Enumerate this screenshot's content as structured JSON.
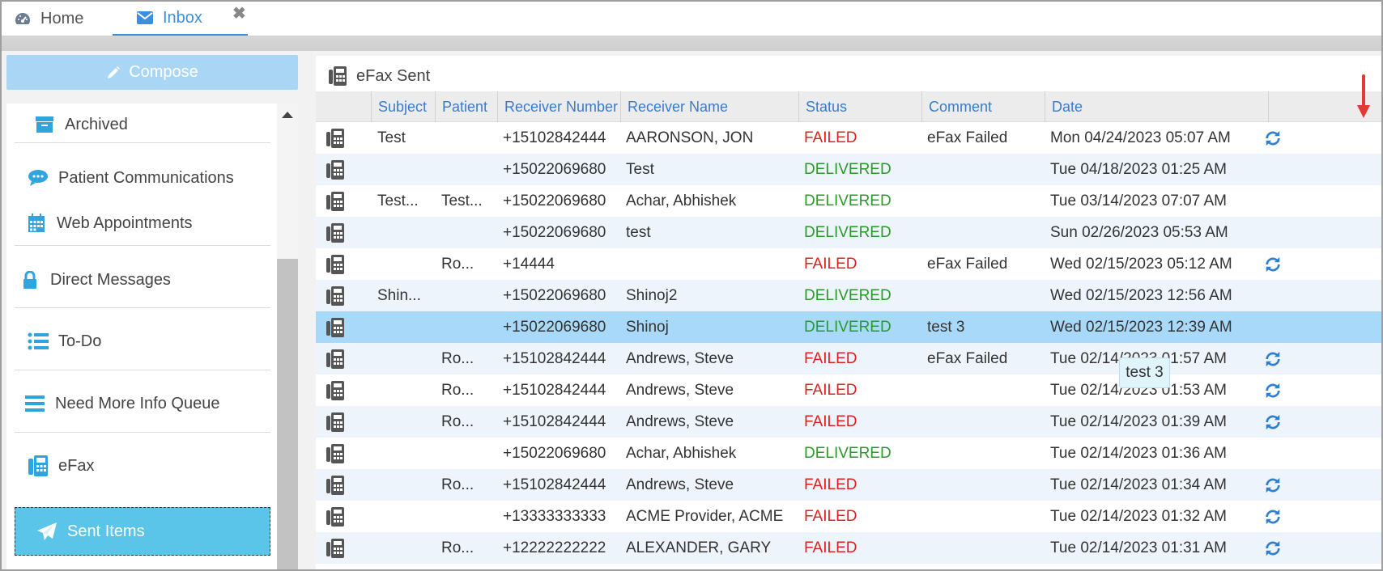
{
  "tabs": {
    "home_label": "Home",
    "inbox_label": "Inbox",
    "close_glyph": "✖"
  },
  "sidebar": {
    "compose_label": "Compose",
    "items": [
      {
        "label": "Archived",
        "icon": "archive-icon"
      },
      {
        "label": "Patient Communications",
        "icon": "chat-icon"
      },
      {
        "label": "Web Appointments",
        "icon": "calendar-icon"
      },
      {
        "label": "Direct Messages",
        "icon": "lock-icon"
      },
      {
        "label": "To-Do",
        "icon": "list-icon"
      },
      {
        "label": "Need More Info Queue",
        "icon": "menu-icon"
      },
      {
        "label": "eFax",
        "icon": "fax-icon"
      },
      {
        "label": "Sent Items",
        "icon": "paper-plane-icon"
      }
    ]
  },
  "panel": {
    "title": "eFax Sent",
    "columns": [
      "Subject",
      "Patient",
      "Receiver Number",
      "Receiver Name",
      "Status",
      "Comment",
      "Date"
    ],
    "rows": [
      {
        "subject": "Test",
        "patient": "",
        "number": "+15102842444",
        "name": "AARONSON, JON",
        "status": "FAILED",
        "comment": "eFax Failed",
        "date": "Mon 04/24/2023 05:07 AM",
        "resend": true
      },
      {
        "subject": "",
        "patient": "",
        "number": "+15022069680",
        "name": "Test",
        "status": "DELIVERED",
        "comment": "",
        "date": "Tue 04/18/2023 01:25 AM",
        "resend": false
      },
      {
        "subject": "Test...",
        "patient": "Test...",
        "number": "+15022069680",
        "name": "Achar, Abhishek",
        "status": "DELIVERED",
        "comment": "",
        "date": "Tue 03/14/2023 07:07 AM",
        "resend": false
      },
      {
        "subject": "",
        "patient": "",
        "number": "+15022069680",
        "name": "test",
        "status": "DELIVERED",
        "comment": "",
        "date": "Sun 02/26/2023 05:53 AM",
        "resend": false
      },
      {
        "subject": "",
        "patient": "Ro...",
        "number": "+14444",
        "name": "",
        "status": "FAILED",
        "comment": "eFax Failed",
        "date": "Wed 02/15/2023 05:12 AM",
        "resend": true
      },
      {
        "subject": "Shin...",
        "patient": "",
        "number": "+15022069680",
        "name": "Shinoj2",
        "status": "DELIVERED",
        "comment": "",
        "date": "Wed 02/15/2023 12:56 AM",
        "resend": false
      },
      {
        "subject": "",
        "patient": "",
        "number": "+15022069680",
        "name": "Shinoj",
        "status": "DELIVERED",
        "comment": "test 3",
        "date": "Wed 02/15/2023 12:39 AM",
        "resend": false,
        "selected": true
      },
      {
        "subject": "",
        "patient": "Ro...",
        "number": "+15102842444",
        "name": "Andrews, Steve",
        "status": "FAILED",
        "comment": "eFax Failed",
        "date": "Tue 02/14/2023 01:57 AM",
        "resend": true
      },
      {
        "subject": "",
        "patient": "Ro...",
        "number": "+15102842444",
        "name": "Andrews, Steve",
        "status": "FAILED",
        "comment": "",
        "date": "Tue 02/14/2023 01:53 AM",
        "resend": true
      },
      {
        "subject": "",
        "patient": "Ro...",
        "number": "+15102842444",
        "name": "Andrews, Steve",
        "status": "FAILED",
        "comment": "",
        "date": "Tue 02/14/2023 01:39 AM",
        "resend": true
      },
      {
        "subject": "",
        "patient": "",
        "number": "+15022069680",
        "name": "Achar, Abhishek",
        "status": "DELIVERED",
        "comment": "",
        "date": "Tue 02/14/2023 01:36 AM",
        "resend": false
      },
      {
        "subject": "",
        "patient": "Ro...",
        "number": "+15102842444",
        "name": "Andrews, Steve",
        "status": "FAILED",
        "comment": "",
        "date": "Tue 02/14/2023 01:34 AM",
        "resend": true
      },
      {
        "subject": "",
        "patient": "",
        "number": "+13333333333",
        "name": "ACME Provider, ACME",
        "status": "FAILED",
        "comment": "",
        "date": "Tue 02/14/2023 01:32 AM",
        "resend": true
      },
      {
        "subject": "",
        "patient": "Ro...",
        "number": "+12222222222",
        "name": "ALEXANDER, GARY",
        "status": "FAILED",
        "comment": "",
        "date": "Tue 02/14/2023 01:31 AM",
        "resend": true
      }
    ]
  },
  "tooltip": {
    "text": "test 3"
  },
  "colors": {
    "accent": "#3d8fdc",
    "failed": "#e02020",
    "delivered": "#2a9a2a",
    "selected_row": "#a9d9f8",
    "active_nav": "#5bc5e9",
    "compose": "#aad6f5"
  }
}
